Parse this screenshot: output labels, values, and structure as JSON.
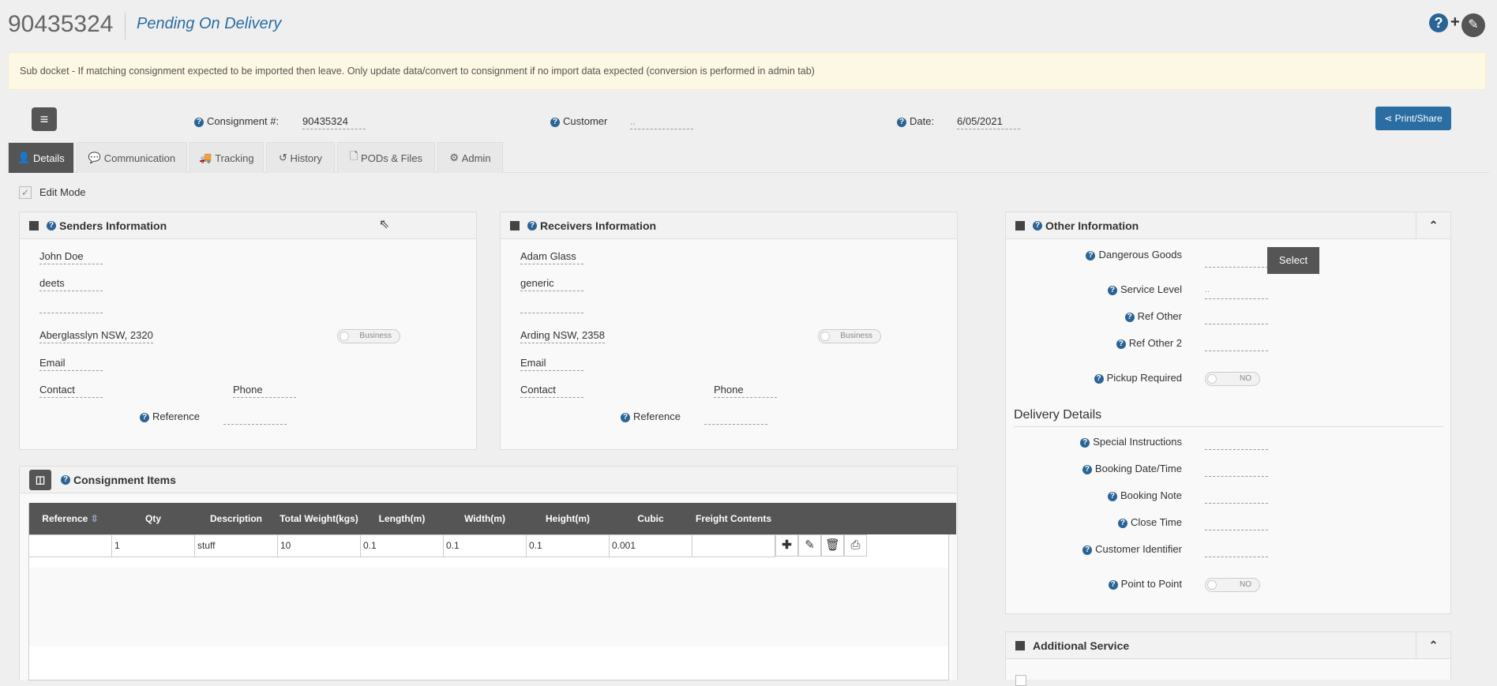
{
  "header": {
    "docket_number": "90435324",
    "status": "Pending On Delivery"
  },
  "notice": "Sub docket - If matching consignment expected to be imported then leave. Only update data/convert to consignment if no import data expected (conversion is performed in admin tab)",
  "summary": {
    "consignment_label": "Consignment #:",
    "consignment_value": "90435324",
    "customer_label": "Customer",
    "customer_value": "..",
    "date_label": "Date:",
    "date_value": "6/05/2021",
    "print_share_label": "Print/Share"
  },
  "tabs": [
    {
      "label": "Details",
      "icon": "user-icon"
    },
    {
      "label": "Communication",
      "icon": "comment-icon"
    },
    {
      "label": "Tracking",
      "icon": "truck-icon"
    },
    {
      "label": "History",
      "icon": "history-icon"
    },
    {
      "label": "PODs & Files",
      "icon": "file-icon"
    },
    {
      "label": "Admin",
      "icon": "gear-icon"
    }
  ],
  "edit_mode_label": "Edit Mode",
  "senders": {
    "title": "Senders Information",
    "name": "John Doe",
    "line2": "deets",
    "line3": "",
    "suburb": "Aberglasslyn NSW, 2320",
    "business_label": "Business",
    "email": "Email",
    "contact": "Contact",
    "phone": "Phone",
    "reference_label": "Reference"
  },
  "receivers": {
    "title": "Receivers Information",
    "name": "Adam Glass",
    "line2": "generic",
    "line3": "",
    "suburb": "Arding NSW, 2358",
    "business_label": "Business",
    "email": "Email",
    "contact": "Contact",
    "phone": "Phone",
    "reference_label": "Reference"
  },
  "other": {
    "title": "Other Information",
    "dangerous_goods_label": "Dangerous Goods",
    "select_label": "Select",
    "service_level_label": "Service Level",
    "service_level_value": "..",
    "ref_other_label": "Ref Other",
    "ref_other2_label": "Ref Other 2",
    "pickup_required_label": "Pickup Required",
    "pickup_toggle": "NO",
    "delivery_details_title": "Delivery Details",
    "special_instructions_label": "Special Instructions",
    "booking_datetime_label": "Booking Date/Time",
    "booking_note_label": "Booking Note",
    "close_time_label": "Close Time",
    "customer_identifier_label": "Customer Identifier",
    "point_to_point_label": "Point to Point",
    "point_toggle": "NO"
  },
  "additional_service": {
    "title": "Additional Service"
  },
  "items": {
    "title": "Consignment Items",
    "columns": [
      "Reference",
      "Qty",
      "Description",
      "Total Weight(kgs)",
      "Length(m)",
      "Width(m)",
      "Height(m)",
      "Cubic",
      "Freight Contents"
    ],
    "rows": [
      [
        "",
        "1",
        "stuff",
        "10",
        "0.1",
        "0.1",
        "0.1",
        "0.001",
        ""
      ]
    ]
  }
}
